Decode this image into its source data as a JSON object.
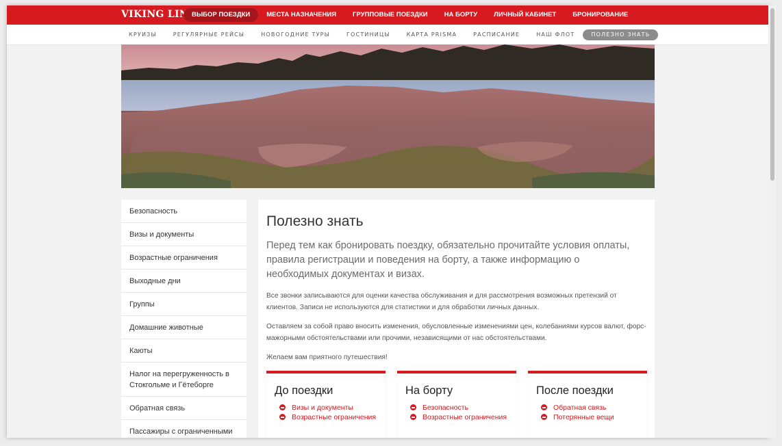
{
  "brand": {
    "logo": "VIKING LINE"
  },
  "main_nav": {
    "items": [
      {
        "label": "ВЫБОР ПОЕЗДКИ",
        "active": true
      },
      {
        "label": "МЕСТА НАЗНАЧЕНИЯ"
      },
      {
        "label": "ГРУППОВЫЕ ПОЕЗДКИ"
      },
      {
        "label": "НА БОРТУ"
      },
      {
        "label": "ЛИЧНЫЙ КАБИНЕТ"
      },
      {
        "label": "БРОНИРОВАНИЕ"
      }
    ]
  },
  "sub_nav": {
    "items": [
      {
        "label": "КРУИЗЫ"
      },
      {
        "label": "РЕГУЛЯРНЫЕ РЕЙСЫ"
      },
      {
        "label": "НОВОГОДНИЕ ТУРЫ"
      },
      {
        "label": "ГОСТИНИЦЫ"
      },
      {
        "label": "КАРТА PRISMA"
      },
      {
        "label": "РАСПИСАНИЕ"
      },
      {
        "label": "НАШ ФЛОТ"
      },
      {
        "label": "ПОЛЕЗНО ЗНАТЬ",
        "active": true
      }
    ]
  },
  "sidebar": {
    "items": [
      {
        "label": "Безопасность"
      },
      {
        "label": "Визы и документы"
      },
      {
        "label": "Возрастные ограничения"
      },
      {
        "label": "Выходные дни"
      },
      {
        "label": "Группы"
      },
      {
        "label": "Домашние животные"
      },
      {
        "label": "Каюты"
      },
      {
        "label": "Налог на перегруженность в Стокгольме и Гётеборге"
      },
      {
        "label": "Обратная связь"
      },
      {
        "label": "Пассажиры с ограниченными"
      }
    ]
  },
  "content": {
    "title": "Полезно знать",
    "lead": "Перед тем как бронировать поездку, обязательно прочитайте условия оплаты, правила регистрации и поведения на борту, а также информацию о необходимых документах и визах.",
    "paragraphs": [
      "Все звонки записываются для оценки качества обслуживания и для рассмотрения возможных претензий от клиентов. Записи не используются для статистики и для обработки личных данных.",
      "Оставляем за собой право вносить изменения, обусловленные изменениями цен, колебаниями курсов валют, форс-мажорными обстоятельствами или прочими, независящими от нас обстоятельствами.",
      "Желаем вам приятного путешествия!"
    ],
    "cards": [
      {
        "title": "До поездки",
        "links": [
          "Визы и документы",
          "Возрастные ограничения"
        ]
      },
      {
        "title": "На борту",
        "links": [
          "Безопасность",
          "Возрастные ограничения"
        ]
      },
      {
        "title": "После поездки",
        "links": [
          "Обратная связь",
          "Потерянные вещи"
        ]
      }
    ]
  },
  "colors": {
    "brand_red": "#d71920",
    "active_nav": "#a4161b",
    "active_subnav": "#8c8c8c",
    "link_red": "#d71920"
  },
  "icons": {
    "card_bullet": "minus-circle-icon"
  }
}
